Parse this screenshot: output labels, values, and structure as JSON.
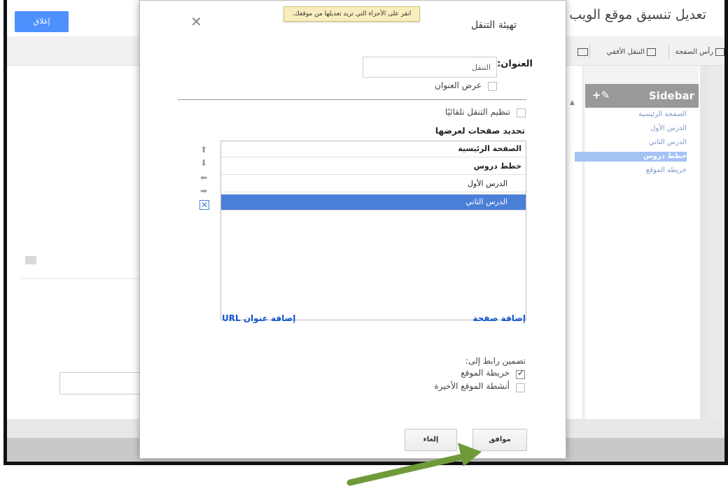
{
  "background": {
    "close_button": "إغلاق",
    "site_title": "تعديل تنسيق موقع الويب",
    "toolbar": {
      "header_label": "رأس الصفحة",
      "horizontal_nav_label": "التنقل الأفقي"
    },
    "sidebar": {
      "title": "Sidebar",
      "tools": "+✎",
      "items": [
        "الصفحة الرئيسية",
        "الدرس الأول",
        "الدرس الثاني",
        "خطط دروس",
        "خريطة الموقع"
      ]
    }
  },
  "dialog": {
    "title": "تهيئة التنقل",
    "tooltip": "انقر على الأجزاء التي تريد تعديلها من موقعك.",
    "title_label": "العنوان:",
    "title_value": "التنقل",
    "show_title_label": "عرض العنوان",
    "auto_organize_label": "تنظيم التنقل تلقائيًا",
    "select_pages_heading": "تحديد صفحات لعرضها",
    "pages": [
      {
        "label": "الصفحة الرئيسية",
        "bold": true,
        "selected": false
      },
      {
        "label": "خطط دروس",
        "bold": true,
        "selected": false
      },
      {
        "label": "الدرس الأول",
        "bold": false,
        "selected": false
      },
      {
        "label": "الدرس الثاني",
        "bold": false,
        "selected": true
      }
    ],
    "add_page_link": "إضافة صفحة",
    "add_url_link": "إضافة عنوان URL",
    "include_link_label": "تضمين رابط إلى:",
    "sitemap_label": "خريطة الموقع",
    "sitemap_checked": true,
    "recent_activity_label": "أنشطة الموقع الأخيرة",
    "recent_activity_checked": false,
    "ok_button": "موافق",
    "cancel_button": "إلغاء"
  },
  "colors": {
    "accent_blue": "#4d90fe",
    "selection_blue": "#4a7fd8",
    "link_blue": "#1155cc",
    "tooltip_yellow": "#f9edbe",
    "annotation_green": "#6f9a3a"
  }
}
